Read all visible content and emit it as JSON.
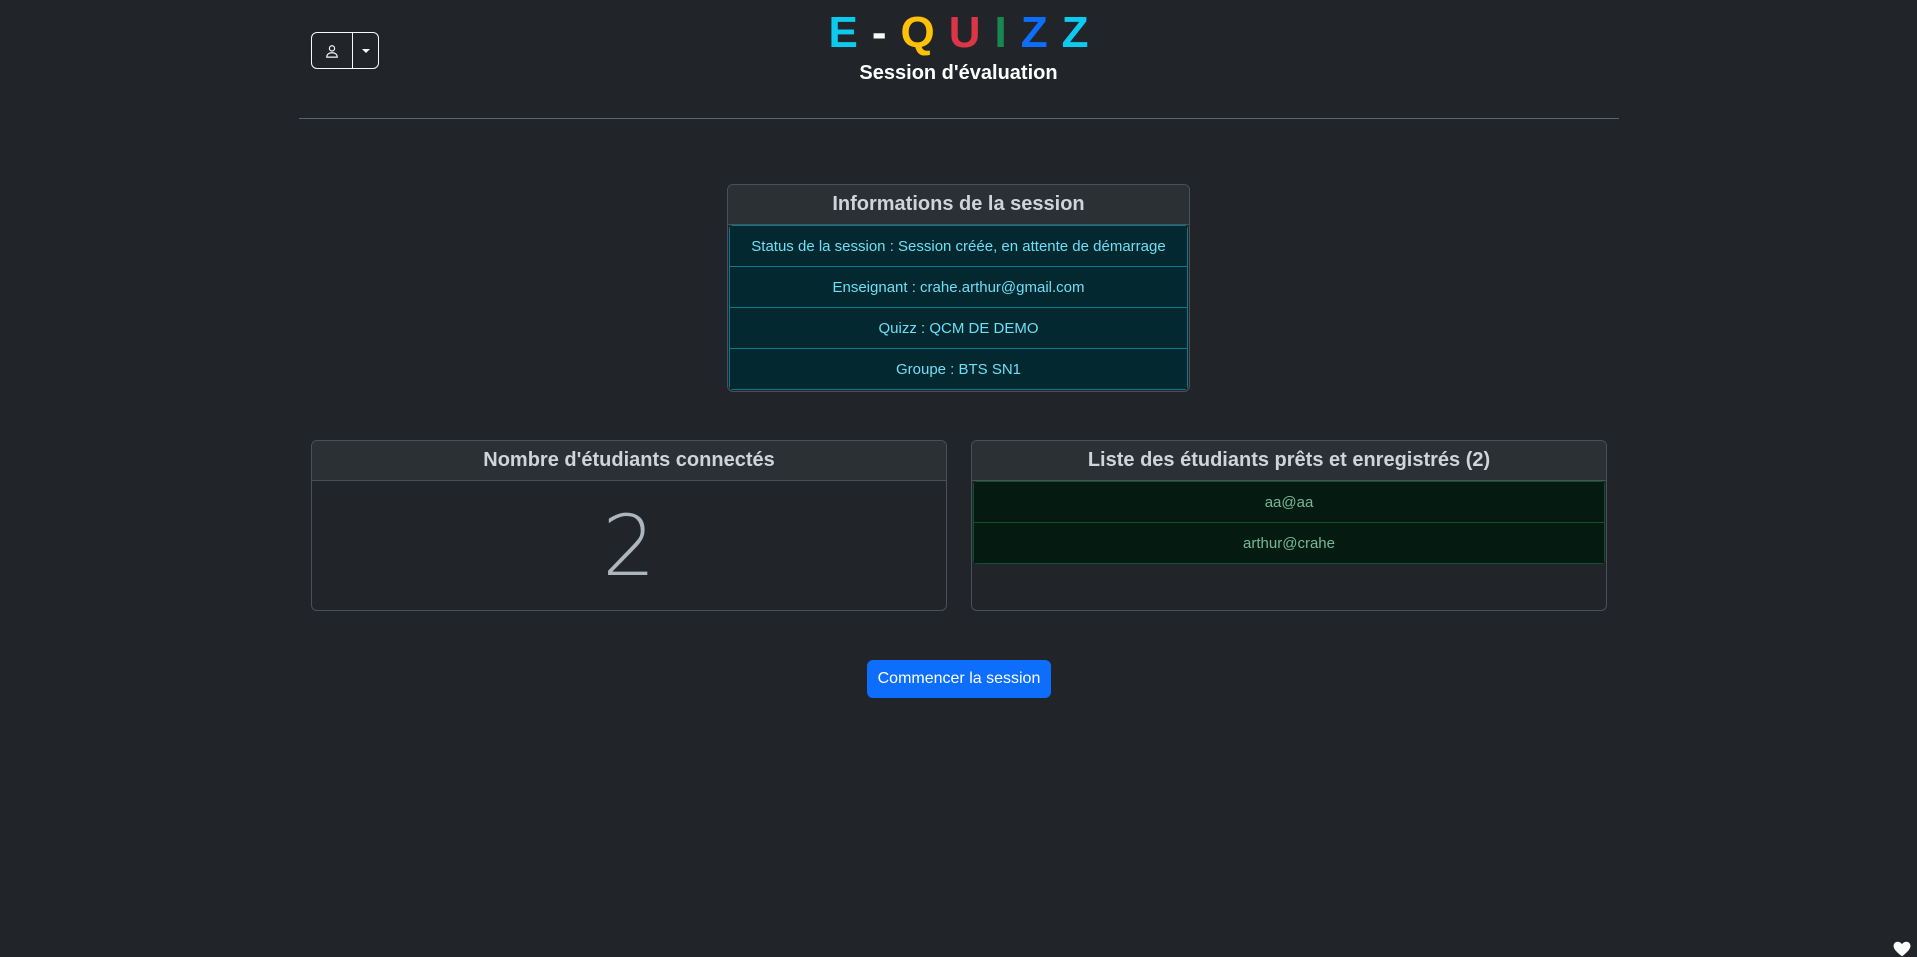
{
  "header": {
    "brand_letters": [
      {
        "char": "E",
        "color": "#0dcaf0"
      },
      {
        "char": "-",
        "color": "#f8f9fa"
      },
      {
        "char": "Q",
        "color": "#ffc107"
      },
      {
        "char": "U",
        "color": "#dc3545"
      },
      {
        "char": "I",
        "color": "#198754"
      },
      {
        "char": "Z",
        "color": "#0d6efd"
      },
      {
        "char": "Z",
        "color": "#0dcaf0"
      }
    ],
    "subtitle": "Session d'évaluation",
    "user_icon": "user-icon",
    "dropdown_icon": "caret-down-icon"
  },
  "session_info": {
    "title": "Informations de la session",
    "items": [
      "Status de la session : Session créée, en attente de démarrage",
      "Enseignant : crahe.arthur@gmail.com",
      "Quizz : QCM DE DEMO",
      "Groupe : BTS SN1"
    ]
  },
  "connected": {
    "title": "Nombre d'étudiants connectés",
    "count": "2"
  },
  "students": {
    "title": "Liste des étudiants prêts et enregistrés (2)",
    "items": [
      "aa@aa",
      "arthur@crahe"
    ]
  },
  "actions": {
    "start_label": "Commencer la session"
  },
  "colors": {
    "accent": "#0d6efd",
    "info_bg": "#032830",
    "info_text": "#6edff6",
    "success_bg": "#051b11",
    "success_text": "#75b798"
  },
  "corner_icon": "heart-icon"
}
